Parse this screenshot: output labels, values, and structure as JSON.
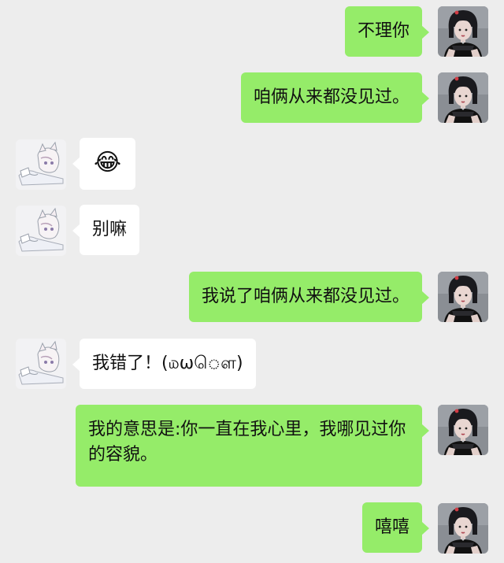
{
  "messages": [
    {
      "side": "me",
      "text": "不理你"
    },
    {
      "side": "me",
      "text": "咱俩从来都没见过。"
    },
    {
      "side": "them",
      "text": "😂",
      "emoji": "face-with-tears-of-joy"
    },
    {
      "side": "them",
      "text": "别嘛"
    },
    {
      "side": "me",
      "text": "我说了咱俩从来都没见过。"
    },
    {
      "side": "them",
      "text": "我错了！(௰ωௌ)"
    },
    {
      "side": "me",
      "text": "我的意思是:你一直在我心里，我哪见过你的容貌。"
    },
    {
      "side": "me",
      "text": "嘻嘻"
    }
  ],
  "colors": {
    "background": "#ededed",
    "my_bubble": "#95ec69",
    "their_bubble": "#ffffff"
  },
  "icons": {
    "my_avatar": "girl-portrait-avatar",
    "their_avatar": "anime-character-avatar"
  }
}
